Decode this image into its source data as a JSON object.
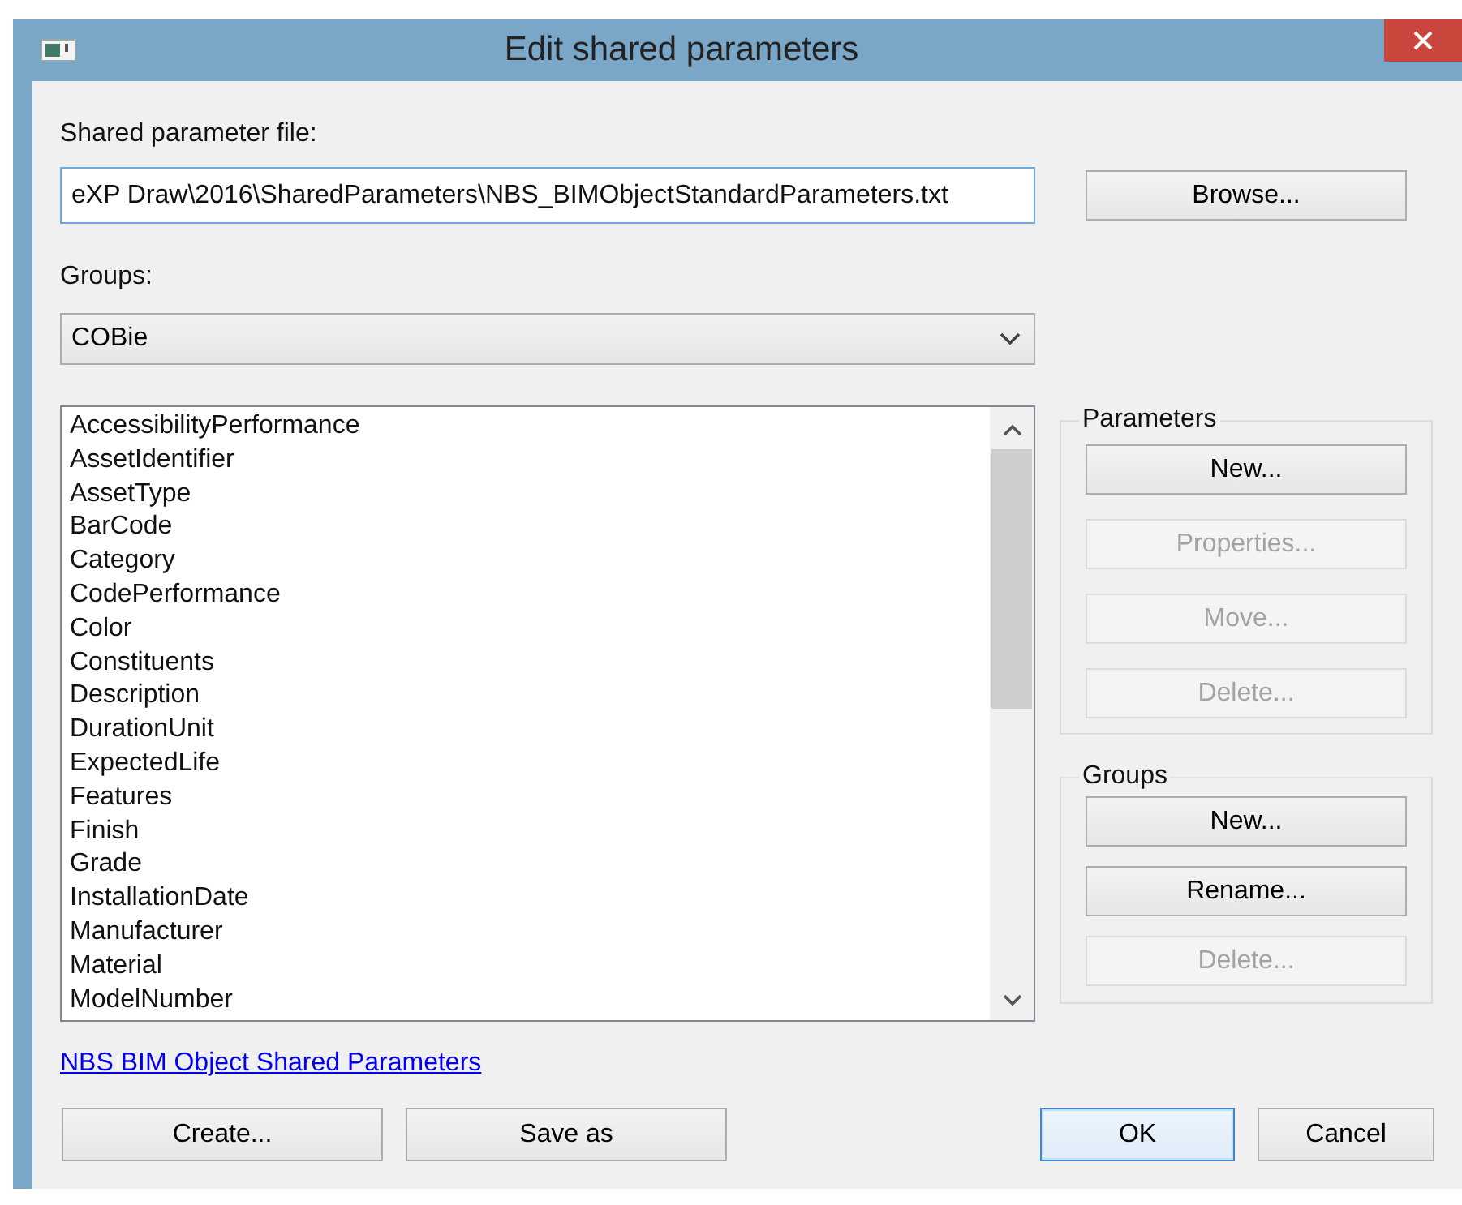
{
  "window": {
    "title": "Edit shared parameters"
  },
  "file": {
    "label": "Shared parameter file:",
    "value": "eXP Draw\\2016\\SharedParameters\\NBS_BIMObjectStandardParameters.txt",
    "browse": "Browse..."
  },
  "groups": {
    "label": "Groups:",
    "value": "COBie"
  },
  "parameters": [
    {
      "name": "AccessibilityPerformance",
      "selected": false
    },
    {
      "name": "AssetIdentifier",
      "selected": false
    },
    {
      "name": "AssetType",
      "selected": false
    },
    {
      "name": "BarCode",
      "selected": false
    },
    {
      "name": "Category",
      "selected": false
    },
    {
      "name": "CodePerformance",
      "selected": false
    },
    {
      "name": "Color",
      "selected": false
    },
    {
      "name": "Constituents",
      "selected": false
    },
    {
      "name": "Description",
      "selected": false
    },
    {
      "name": "DurationUnit",
      "selected": false
    },
    {
      "name": "ExpectedLife",
      "selected": false
    },
    {
      "name": "Features",
      "selected": false
    },
    {
      "name": "Finish",
      "selected": false
    },
    {
      "name": "Grade",
      "selected": false
    },
    {
      "name": "InstallationDate",
      "selected": false
    },
    {
      "name": "Manufacturer",
      "selected": false
    },
    {
      "name": "Material",
      "selected": false
    },
    {
      "name": "ModelNumber",
      "selected": false
    }
  ],
  "button_groups": [
    {
      "title": "Parameters",
      "buttons": [
        {
          "label": "New...",
          "disabled": false
        },
        {
          "label": "Properties...",
          "disabled": true
        },
        {
          "label": "Move...",
          "disabled": true
        },
        {
          "label": "Delete...",
          "disabled": true
        }
      ]
    },
    {
      "title": "Groups",
      "buttons": [
        {
          "label": "New...",
          "disabled": false
        },
        {
          "label": "Rename...",
          "disabled": false
        },
        {
          "label": "Delete...",
          "disabled": true
        }
      ]
    }
  ],
  "link": "NBS BIM Object Shared Parameters",
  "footer_buttons": [
    {
      "label": "Create...",
      "default": false
    },
    {
      "label": "Save as",
      "default": false
    },
    {
      "label": "OK",
      "default": true
    },
    {
      "label": "Cancel",
      "default": false
    }
  ]
}
